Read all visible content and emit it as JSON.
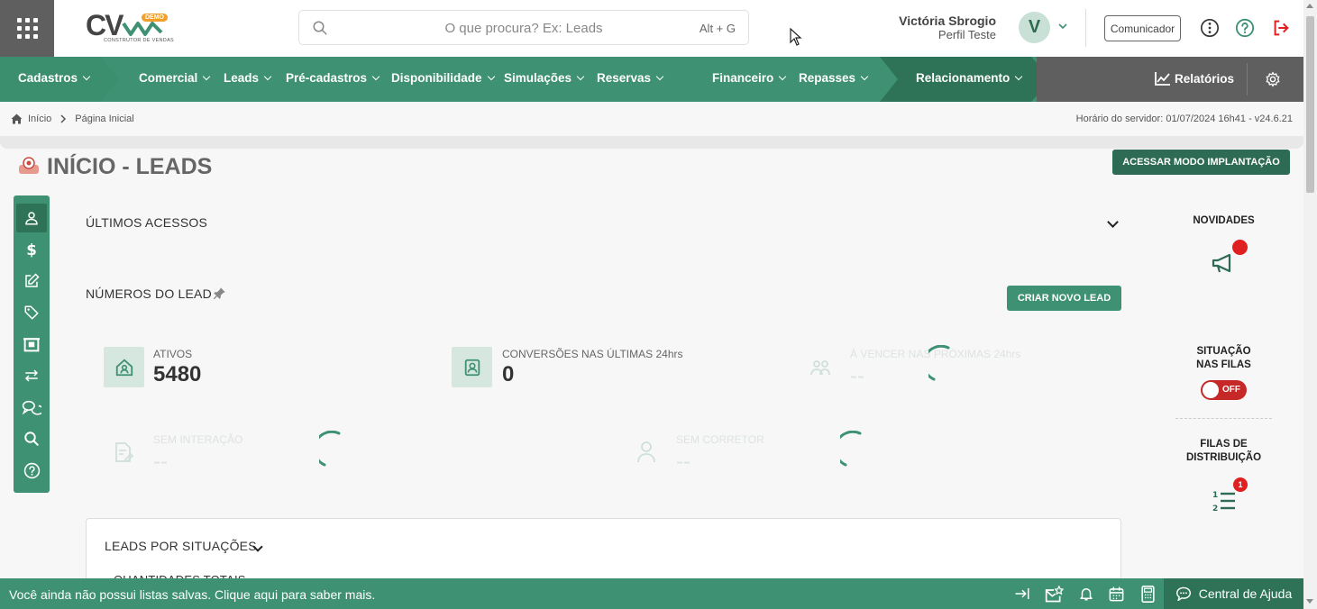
{
  "header": {
    "logo_text": "CV",
    "logo_badge": "DEMO",
    "logo_subtitle": "CONSTRUTOR DE VENDAS",
    "search": {
      "placeholder": "O que procura? Ex: Leads",
      "shortcut": "Alt + G"
    },
    "user": {
      "name": "Victória Sbrogio",
      "role": "Perfil Teste",
      "initial": "V"
    },
    "comunicador_label": "Comunicador"
  },
  "nav": {
    "items": [
      {
        "label": "Cadastros"
      },
      {
        "label": "Comercial"
      },
      {
        "label": "Leads"
      },
      {
        "label": "Pré-cadastros"
      },
      {
        "label": "Disponibilidade"
      },
      {
        "label": "Simulações"
      },
      {
        "label": "Reservas"
      },
      {
        "label": "Financeiro"
      },
      {
        "label": "Repasses"
      },
      {
        "label": "Relacionamento"
      }
    ],
    "relatorios_label": "Relatórios"
  },
  "breadcrumb": {
    "home": "Início",
    "current": "Página Inicial"
  },
  "server_time": "Horário do servidor: 01/07/2024 16h41 - v24.6.21",
  "page": {
    "title": "INÍCIO - LEADS",
    "implantacao_button": "ACESSAR MODO IMPLANTAÇÃO"
  },
  "sections": {
    "ultimos_acessos": "ÚLTIMOS ACESSOS",
    "numeros_lead": "NÚMEROS DO LEAD",
    "criar_novo_lead": "CRIAR NOVO LEAD",
    "leads_por_situacoes": "LEADS POR SITUAÇÕES",
    "quantidades_totais": "QUANTIDADES TOTAIS"
  },
  "stats": [
    {
      "label": "ATIVOS",
      "value": "5480"
    },
    {
      "label": "CONVERSÕES NAS ÚLTIMAS 24hrs",
      "value": "0"
    },
    {
      "label": "À VENCER NAS PRÓXIMAS 24hrs",
      "value": "--"
    },
    {
      "label": "SEM INTERAÇÃO",
      "value": "--"
    },
    {
      "label": "SEM CORRETOR",
      "value": "--"
    }
  ],
  "right_panel": {
    "novidades": "NOVIDADES",
    "situacao_l1": "SITUAÇÃO",
    "situacao_l2": "NAS FILAS",
    "toggle_state": "OFF",
    "filas_l1": "FILAS DE",
    "filas_l2": "DISTRIBUIÇÃO",
    "filas_badge": "1"
  },
  "bottom_bar": {
    "message": "Você ainda não possui listas salvas. Clique aqui para saber mais.",
    "help_label": "Central de Ajuda"
  },
  "colors": {
    "primary_green": "#3e9172",
    "dark_green": "#2e7358",
    "gray_nav": "#5f5f5f",
    "alert_red": "#e02020"
  }
}
